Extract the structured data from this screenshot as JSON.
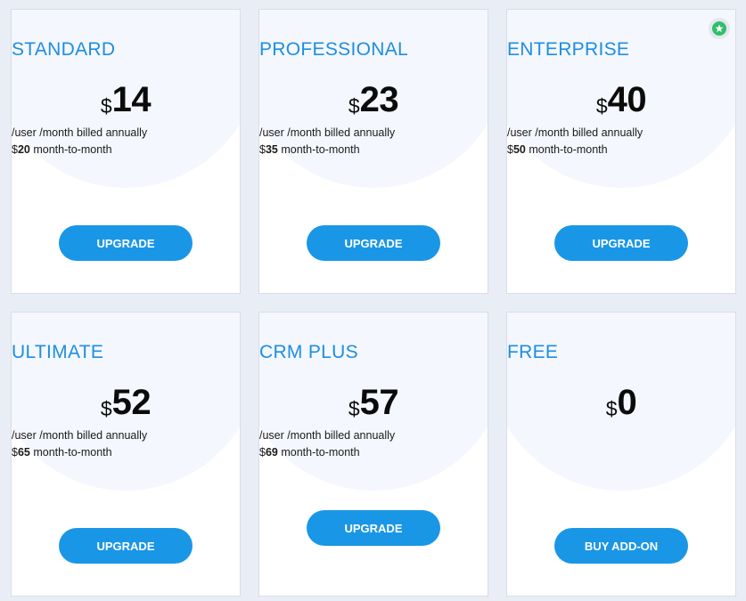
{
  "plans": [
    {
      "name": "STANDARD",
      "currency": "$",
      "price": "14",
      "billing": "/user /month billed annually",
      "monthly_price": "20",
      "monthly_suffix": " month-to-month",
      "button": "UPGRADE"
    },
    {
      "name": "PROFESSIONAL",
      "currency": "$",
      "price": "23",
      "billing": "/user /month billed annually",
      "monthly_price": "35",
      "monthly_suffix": " month-to-month",
      "button": "UPGRADE"
    },
    {
      "name": "ENTERPRISE",
      "currency": "$",
      "price": "40",
      "billing": "/user /month billed annually",
      "monthly_price": "50",
      "monthly_suffix": " month-to-month",
      "button": "UPGRADE",
      "badge_icon": "star-icon"
    },
    {
      "name": "ULTIMATE",
      "currency": "$",
      "price": "52",
      "billing": "/user /month billed annually",
      "monthly_price": "65",
      "monthly_suffix": " month-to-month",
      "button": "UPGRADE"
    },
    {
      "name": "CRM PLUS",
      "currency": "$",
      "price": "57",
      "billing": "/user /month billed annually",
      "monthly_price": "69",
      "monthly_suffix": " month-to-month",
      "button": "UPGRADE"
    },
    {
      "name": "FREE",
      "currency": "$",
      "price": "0",
      "button": "BUY ADD-ON"
    }
  ],
  "colors": {
    "accent": "#1a96e6",
    "plan_name": "#1e8ee0",
    "badge": "#2fbf6b",
    "background": "#e9edf5"
  }
}
